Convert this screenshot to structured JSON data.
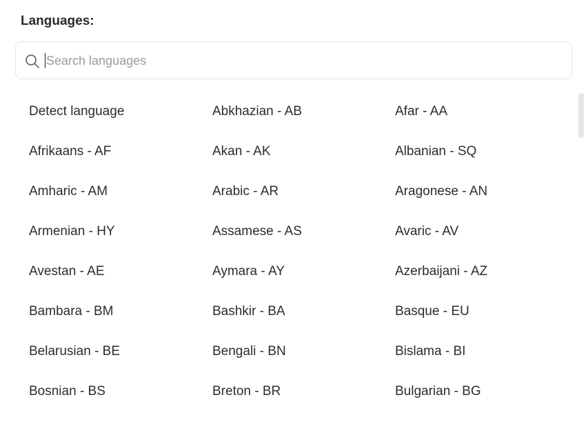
{
  "header": {
    "title": "Languages:"
  },
  "search": {
    "placeholder": "Search languages",
    "value": ""
  },
  "languages": [
    [
      "Detect language",
      "Abkhazian - AB",
      "Afar - AA"
    ],
    [
      "Afrikaans - AF",
      "Akan - AK",
      "Albanian - SQ"
    ],
    [
      "Amharic - AM",
      "Arabic - AR",
      "Aragonese - AN"
    ],
    [
      "Armenian - HY",
      "Assamese - AS",
      "Avaric - AV"
    ],
    [
      "Avestan - AE",
      "Aymara - AY",
      "Azerbaijani - AZ"
    ],
    [
      "Bambara - BM",
      "Bashkir - BA",
      "Basque - EU"
    ],
    [
      "Belarusian - BE",
      "Bengali - BN",
      "Bislama - BI"
    ],
    [
      "Bosnian - BS",
      "Breton - BR",
      "Bulgarian - BG"
    ]
  ],
  "colors": {
    "text": "#2c2c2c",
    "placeholder": "#9a9aa2",
    "border": "#e3e3e6"
  },
  "icons": {
    "search": "search-icon"
  }
}
